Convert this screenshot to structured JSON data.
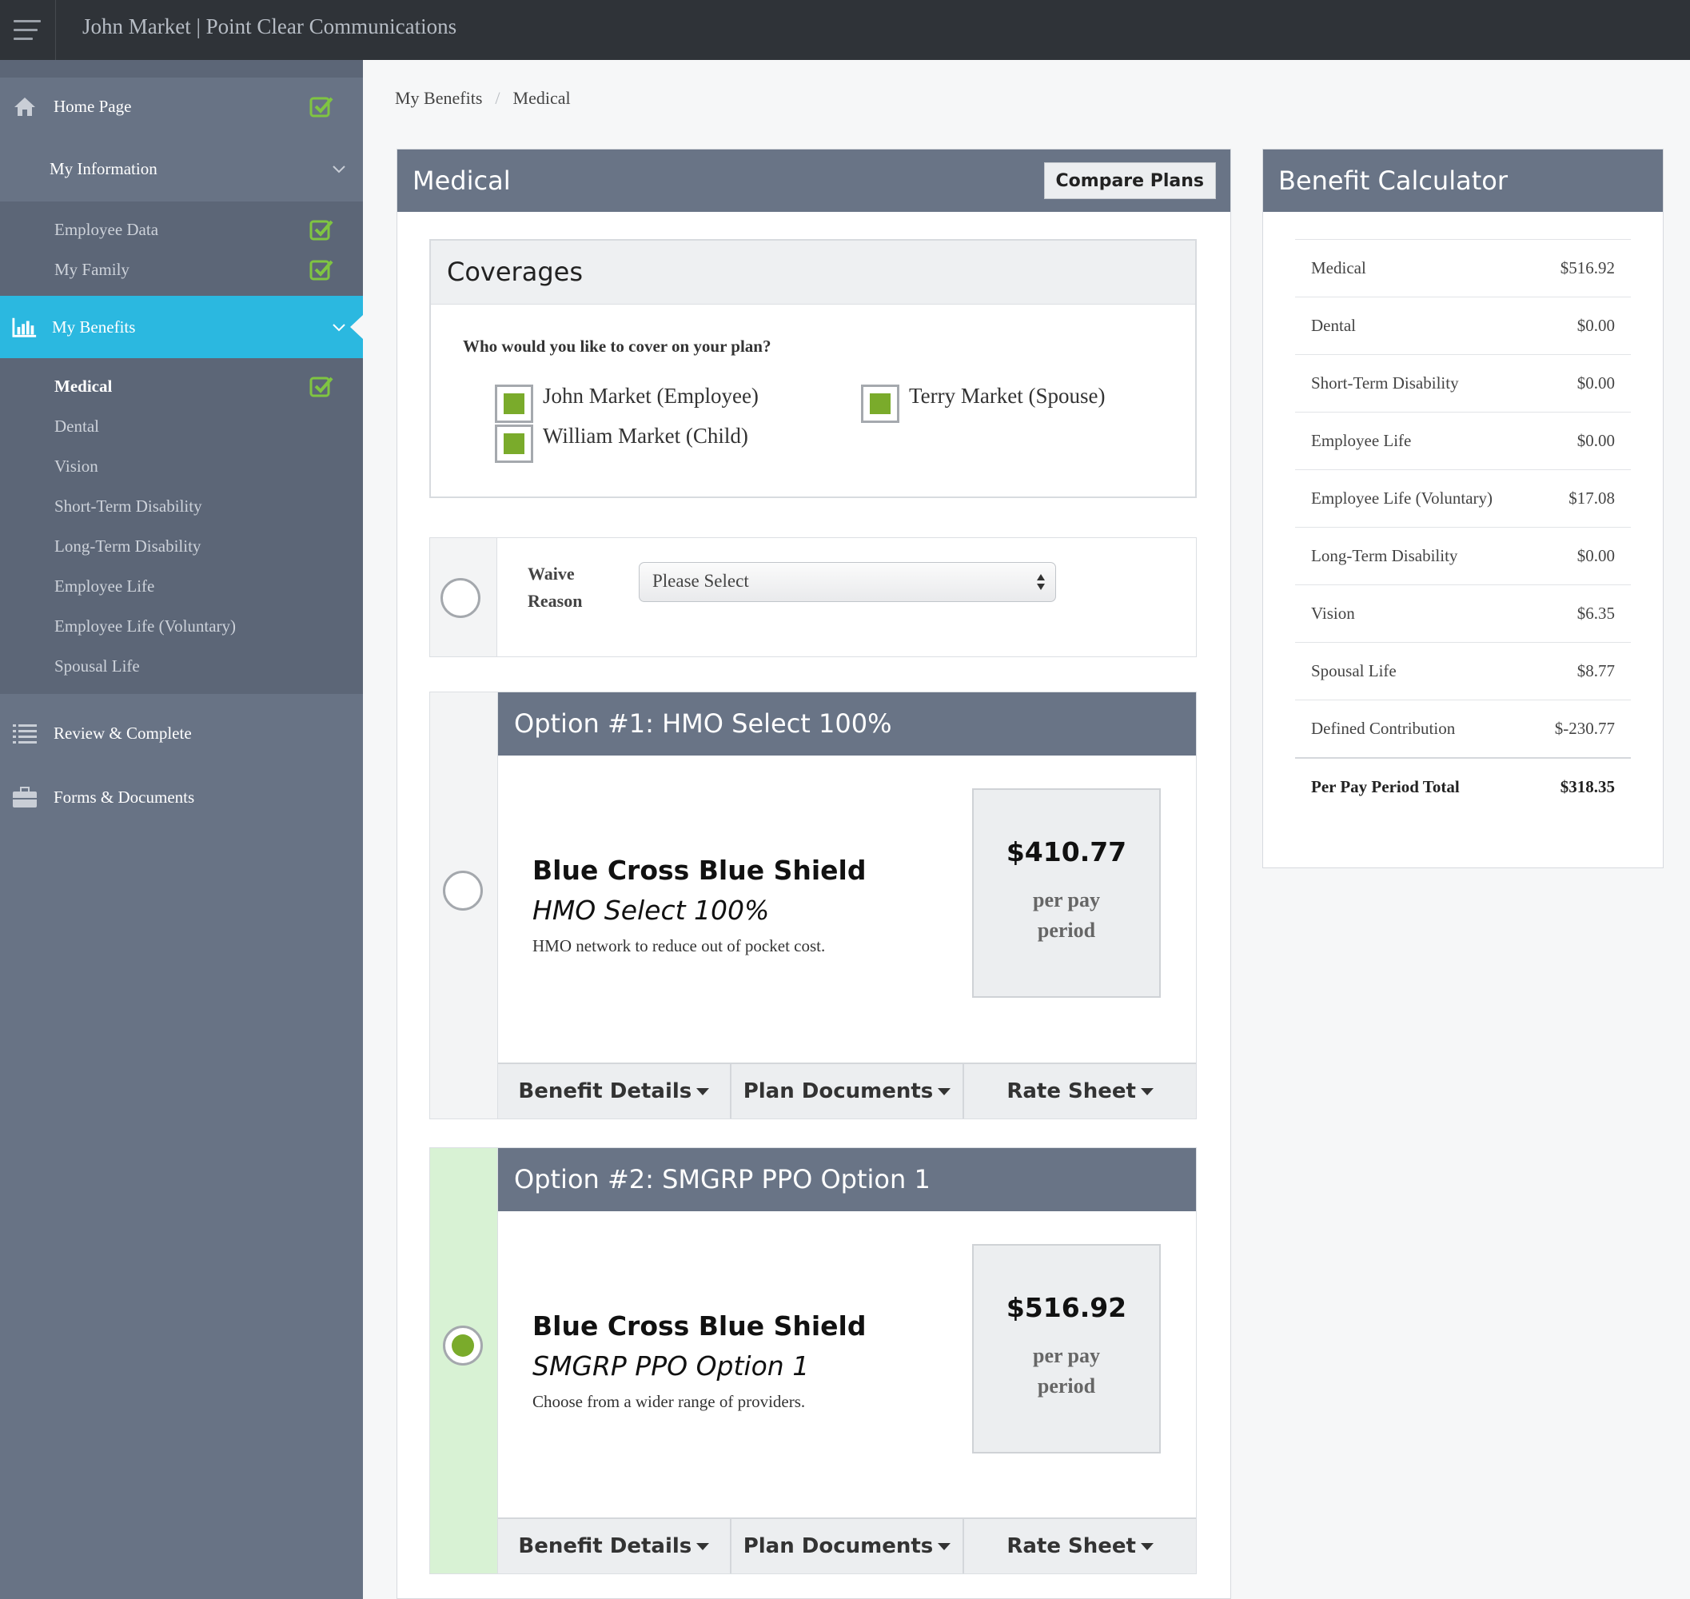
{
  "app": {
    "title": "John Market | Point Clear Communications"
  },
  "sidebar": {
    "home": "Home Page",
    "my_information": "My Information",
    "info_items": [
      "Employee Data",
      "My Family"
    ],
    "my_benefits": "My Benefits",
    "benefit_items": [
      "Medical",
      "Dental",
      "Vision",
      "Short-Term Disability",
      "Long-Term Disability",
      "Employee Life",
      "Employee Life (Voluntary)",
      "Spousal Life"
    ],
    "review": "Review & Complete",
    "forms": "Forms & Documents",
    "colors": {
      "active": "#2bb8e0",
      "check": "#7fc541"
    }
  },
  "breadcrumb": [
    "My Benefits",
    "Medical"
  ],
  "medical": {
    "title": "Medical",
    "compare_label": "Compare Plans",
    "coverages": {
      "title": "Coverages",
      "question": "Who would you like to cover on your plan?",
      "members": [
        {
          "name": "John Market (Employee)",
          "checked": true
        },
        {
          "name": "Terry Market (Spouse)",
          "checked": true
        },
        {
          "name": "William Market (Child)",
          "checked": true
        }
      ]
    },
    "waive": {
      "label": "Waive Reason",
      "select_value": "Please Select",
      "selected": false
    },
    "options": [
      {
        "header": "Option #1: HMO Select 100%",
        "carrier": "Blue Cross Blue Shield",
        "plan": "HMO Select 100%",
        "description": "HMO network to reduce out of pocket cost.",
        "price": "$410.77",
        "price_unit": "per pay period",
        "selected": false,
        "buttons": [
          "Benefit Details",
          "Plan Documents",
          "Rate Sheet"
        ]
      },
      {
        "header": "Option #2: SMGRP PPO Option 1",
        "carrier": "Blue Cross Blue Shield",
        "plan": "SMGRP PPO Option 1",
        "description": "Choose from a wider range of providers.",
        "price": "$516.92",
        "price_unit": "per pay period",
        "selected": true,
        "buttons": [
          "Benefit Details",
          "Plan Documents",
          "Rate Sheet"
        ]
      }
    ]
  },
  "calculator": {
    "title": "Benefit Calculator",
    "rows": [
      {
        "label": "Medical",
        "value": "$516.92"
      },
      {
        "label": "Dental",
        "value": "$0.00"
      },
      {
        "label": "Short-Term Disability",
        "value": "$0.00"
      },
      {
        "label": "Employee Life",
        "value": "$0.00"
      },
      {
        "label": "Employee Life (Voluntary)",
        "value": "$17.08"
      },
      {
        "label": "Long-Term Disability",
        "value": "$0.00"
      },
      {
        "label": "Vision",
        "value": "$6.35"
      },
      {
        "label": "Spousal Life",
        "value": "$8.77"
      },
      {
        "label": "Defined Contribution",
        "value": "$-230.77"
      }
    ],
    "total": {
      "label": "Per Pay Period Total",
      "value": "$318.35"
    }
  }
}
